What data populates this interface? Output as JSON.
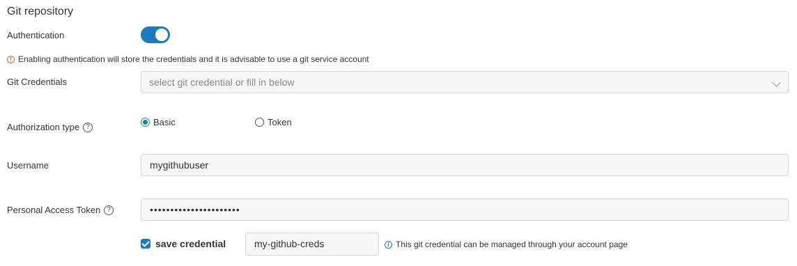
{
  "section": {
    "title": "Git repository"
  },
  "authentication": {
    "label": "Authentication",
    "enabled": true
  },
  "warning": {
    "text": "Enabling authentication will store the credentials and it is advisable to use a git service account",
    "icon": "warning-icon"
  },
  "git_credentials": {
    "label": "Git Credentials",
    "placeholder": "select git credential or fill in below",
    "icon": "chevron-down-icon"
  },
  "authorization": {
    "label": "Authorization type",
    "help": "?",
    "options": [
      {
        "label": "Basic",
        "selected": true
      },
      {
        "label": "Token",
        "selected": false
      }
    ]
  },
  "username": {
    "label": "Username",
    "value": "mygithubuser"
  },
  "token": {
    "label": "Personal Access Token",
    "help": "?",
    "value": "••••••••••••••••••••••"
  },
  "save": {
    "label": "save credential",
    "checked": true,
    "name_value": "my-github-creds",
    "info_text": "This git credential can be managed through your account page",
    "info_icon": "info-icon"
  },
  "colors": {
    "accent": "#1a7bbf",
    "warning": "#d2691e",
    "field_bg": "#f7f7f7",
    "field_border": "#d4d4d4"
  }
}
